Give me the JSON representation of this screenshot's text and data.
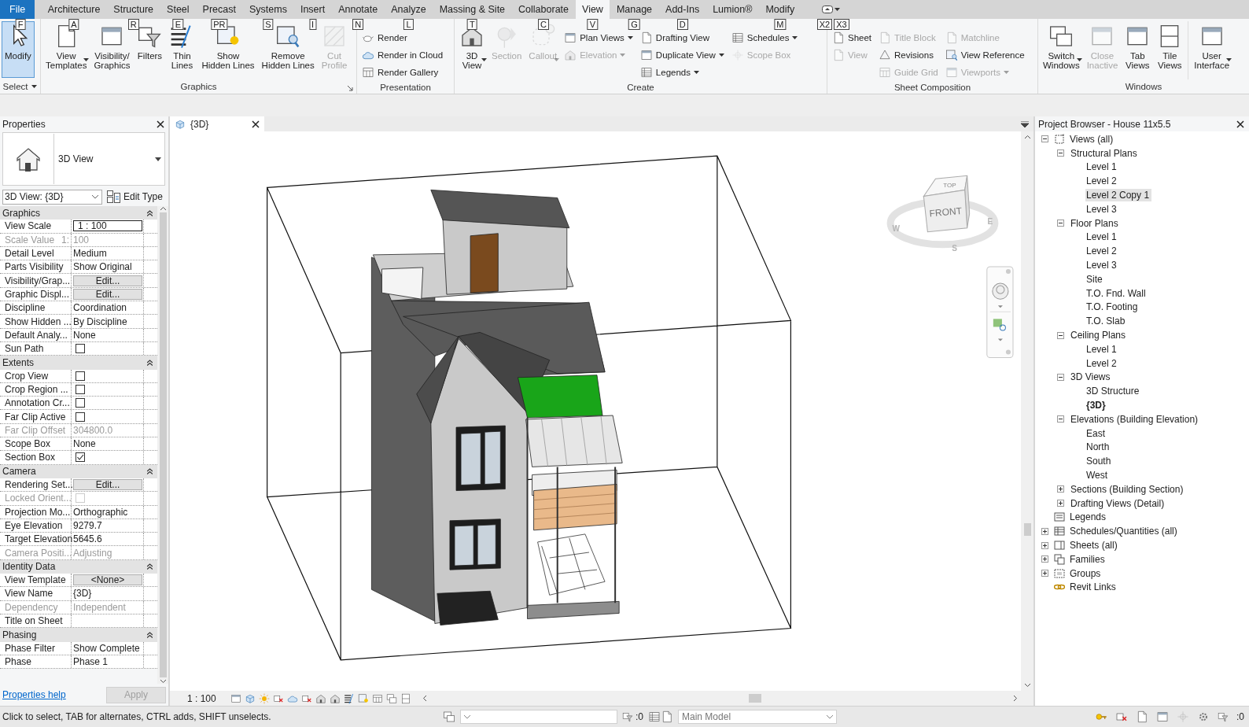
{
  "menu_tabs": [
    {
      "label": "File",
      "keytip": "F",
      "selected": false,
      "kind": "file"
    },
    {
      "label": "Architecture",
      "keytip": "A",
      "selected": false,
      "kind": "tab"
    },
    {
      "label": "Structure",
      "keytip": "R",
      "selected": false,
      "kind": "tab"
    },
    {
      "label": "Steel",
      "keytip": "E",
      "selected": false,
      "kind": "tab"
    },
    {
      "label": "Precast",
      "keytip": "PR",
      "selected": false,
      "kind": "tab"
    },
    {
      "label": "Systems",
      "keytip": "S",
      "selected": false,
      "kind": "tab"
    },
    {
      "label": "Insert",
      "keytip": "I",
      "selected": false,
      "kind": "tab"
    },
    {
      "label": "Annotate",
      "keytip": "N",
      "selected": false,
      "kind": "tab"
    },
    {
      "label": "Analyze",
      "keytip": "L",
      "selected": false,
      "kind": "tab"
    },
    {
      "label": "Massing & Site",
      "keytip": "T",
      "selected": false,
      "kind": "tab"
    },
    {
      "label": "Collaborate",
      "keytip": "C",
      "selected": false,
      "kind": "tab"
    },
    {
      "label": "View",
      "keytip": "V",
      "selected": true,
      "kind": "tab"
    },
    {
      "label": "Manage",
      "keytip": "G",
      "selected": false,
      "kind": "tab"
    },
    {
      "label": "Add-Ins",
      "keytip": "D",
      "selected": false,
      "kind": "tab"
    },
    {
      "label": "Lumion®",
      "selected": false,
      "kind": "tab"
    },
    {
      "label": "Modify",
      "keytip": "M",
      "selected": false,
      "kind": "tab"
    }
  ],
  "ribbon_toggle": {
    "keytips": [
      "X2",
      "X3"
    ]
  },
  "ribbon": {
    "panels": [
      {
        "title": "Select",
        "menu": true,
        "items": [
          {
            "kind": "large",
            "label": "Modify",
            "selected": true,
            "disabled": false
          }
        ]
      },
      {
        "title": "Graphics",
        "launcher": true,
        "items": [
          {
            "kind": "large",
            "label": "View\nTemplates",
            "selected": false,
            "disabled": false,
            "dropdown": true
          },
          {
            "kind": "large",
            "label": "Visibility/\nGraphics",
            "selected": false,
            "disabled": false
          },
          {
            "kind": "large",
            "label": "Filters",
            "selected": false,
            "disabled": false
          },
          {
            "kind": "large",
            "label": "Thin\nLines",
            "selected": false,
            "disabled": false
          },
          {
            "kind": "large",
            "label": "Show\nHidden Lines",
            "selected": false,
            "disabled": false
          },
          {
            "kind": "large",
            "label": "Remove\nHidden Lines",
            "selected": false,
            "disabled": false
          },
          {
            "kind": "large",
            "label": "Cut\nProfile",
            "selected": false,
            "disabled": true
          }
        ]
      },
      {
        "title": "Presentation",
        "items": [
          {
            "kind": "stack",
            "buttons": [
              {
                "label": "Render",
                "disabled": false
              },
              {
                "label": "Render in Cloud",
                "disabled": false
              },
              {
                "label": "Render Gallery",
                "disabled": false
              }
            ]
          }
        ]
      },
      {
        "title": "Create",
        "items": [
          {
            "kind": "large",
            "label": "3D\nView",
            "selected": false,
            "disabled": false,
            "dropdown": true
          },
          {
            "kind": "large",
            "label": "Section",
            "selected": false,
            "disabled": true
          },
          {
            "kind": "large",
            "label": "Callout",
            "selected": false,
            "disabled": true,
            "dropdown": true
          },
          {
            "kind": "stack",
            "buttons": [
              {
                "label": "Plan Views",
                "disabled": false,
                "dropdown": true
              },
              {
                "label": "Elevation",
                "disabled": true,
                "dropdown": true
              }
            ]
          },
          {
            "kind": "stack",
            "buttons": [
              {
                "label": "Drafting View",
                "disabled": false
              },
              {
                "label": "Duplicate View",
                "disabled": false,
                "dropdown": true
              },
              {
                "label": "Legends",
                "disabled": false,
                "dropdown": true
              }
            ]
          },
          {
            "kind": "stack",
            "buttons": [
              {
                "label": "Schedules",
                "disabled": false,
                "dropdown": true
              },
              {
                "label": "Scope Box",
                "disabled": true
              }
            ]
          }
        ]
      },
      {
        "title": "Sheet Composition",
        "items": [
          {
            "kind": "stack",
            "buttons": [
              {
                "label": "Sheet",
                "disabled": false
              },
              {
                "label": "View",
                "disabled": true
              }
            ]
          },
          {
            "kind": "stack",
            "buttons": [
              {
                "label": "Title Block",
                "disabled": true
              },
              {
                "label": "Revisions",
                "disabled": false
              },
              {
                "label": "Guide Grid",
                "disabled": true
              }
            ]
          },
          {
            "kind": "stack",
            "buttons": [
              {
                "label": "Matchline",
                "disabled": true
              },
              {
                "label": "View Reference",
                "disabled": false
              },
              {
                "label": "Viewports",
                "disabled": true,
                "dropdown": true
              }
            ]
          }
        ]
      },
      {
        "title": "Windows",
        "items": [
          {
            "kind": "large",
            "label": "Switch\nWindows",
            "selected": false,
            "disabled": false,
            "dropdown": true
          },
          {
            "kind": "large",
            "label": "Close\nInactive",
            "selected": false,
            "disabled": true
          },
          {
            "kind": "large",
            "label": "Tab\nViews",
            "selected": false,
            "disabled": false
          },
          {
            "kind": "large",
            "label": "Tile\nViews",
            "selected": false,
            "disabled": false
          },
          {
            "kind": "large",
            "label": "User\nInterface",
            "selected": false,
            "disabled": false,
            "dropdown": true
          }
        ]
      }
    ]
  },
  "properties": {
    "title": "Properties",
    "type_name": "3D View",
    "instance_selector": "3D View: {3D}",
    "edit_type": "Edit Type",
    "groups": [
      {
        "title": "Graphics",
        "rows": [
          {
            "label": "View Scale",
            "kind": "field",
            "value": "1 : 100",
            "disabled": false
          },
          {
            "label": "Scale Value",
            "unit": "1:",
            "kind": "text",
            "value": "100",
            "disabled": true
          },
          {
            "label": "Detail Level",
            "kind": "text",
            "value": "Medium",
            "disabled": false
          },
          {
            "label": "Parts Visibility",
            "kind": "text",
            "value": "Show Original",
            "disabled": false
          },
          {
            "label": "Visibility/Grap...",
            "kind": "button",
            "value": "Edit...",
            "disabled": false
          },
          {
            "label": "Graphic Displ...",
            "kind": "button",
            "value": "Edit...",
            "disabled": false
          },
          {
            "label": "Discipline",
            "kind": "text",
            "value": "Coordination",
            "disabled": false
          },
          {
            "label": "Show Hidden ...",
            "kind": "text",
            "value": "By Discipline",
            "disabled": false
          },
          {
            "label": "Default Analy...",
            "kind": "text",
            "value": "None",
            "disabled": false
          },
          {
            "label": "Sun Path",
            "kind": "checkbox",
            "checked": false,
            "disabled": false
          }
        ]
      },
      {
        "title": "Extents",
        "rows": [
          {
            "label": "Crop View",
            "kind": "checkbox",
            "checked": false,
            "disabled": false
          },
          {
            "label": "Crop Region ...",
            "kind": "checkbox",
            "checked": false,
            "disabled": false
          },
          {
            "label": "Annotation Cr...",
            "kind": "checkbox",
            "checked": false,
            "disabled": false
          },
          {
            "label": "Far Clip Active",
            "kind": "checkbox",
            "checked": false,
            "disabled": false
          },
          {
            "label": "Far Clip Offset",
            "kind": "text",
            "value": "304800.0",
            "disabled": true
          },
          {
            "label": "Scope Box",
            "kind": "text",
            "value": "None",
            "disabled": false
          },
          {
            "label": "Section Box",
            "kind": "checkbox",
            "checked": true,
            "disabled": false
          }
        ]
      },
      {
        "title": "Camera",
        "rows": [
          {
            "label": "Rendering Set...",
            "kind": "button",
            "value": "Edit...",
            "disabled": false
          },
          {
            "label": "Locked Orient...",
            "kind": "checkbox",
            "checked": false,
            "disabled": true
          },
          {
            "label": "Projection Mo...",
            "kind": "text",
            "value": "Orthographic",
            "disabled": false
          },
          {
            "label": "Eye Elevation",
            "kind": "text",
            "value": "9279.7",
            "disabled": false
          },
          {
            "label": "Target Elevation",
            "kind": "text",
            "value": "5645.6",
            "disabled": false
          },
          {
            "label": "Camera Positi...",
            "kind": "text",
            "value": "Adjusting",
            "disabled": true
          }
        ]
      },
      {
        "title": "Identity Data",
        "rows": [
          {
            "label": "View Template",
            "kind": "button",
            "value": "<None>",
            "disabled": false
          },
          {
            "label": "View Name",
            "kind": "text",
            "value": "{3D}",
            "disabled": false
          },
          {
            "label": "Dependency",
            "kind": "text",
            "value": "Independent",
            "disabled": true
          },
          {
            "label": "Title on Sheet",
            "kind": "text",
            "disabled": false
          }
        ]
      },
      {
        "title": "Phasing",
        "rows": [
          {
            "label": "Phase Filter",
            "kind": "text",
            "value": "Show Complete",
            "disabled": false
          },
          {
            "label": "Phase",
            "kind": "text",
            "value": "Phase 1",
            "disabled": false
          }
        ]
      }
    ],
    "help_link": "Properties help",
    "apply": {
      "label": "Apply",
      "disabled": true
    }
  },
  "view_tab": {
    "title": "{3D}"
  },
  "viewcube": {
    "face": "FRONT",
    "top": "TOP",
    "compass": [
      "W",
      "E",
      "S"
    ]
  },
  "view_control_bar": {
    "scale": "1 : 100"
  },
  "project_browser": {
    "title": "Project Browser - House 11x5.5",
    "tree": [
      {
        "label": "Views (all)",
        "kind": "views",
        "expanded": true,
        "selected": false,
        "current": false,
        "children": [
          {
            "label": "Structural Plans",
            "expanded": true,
            "selected": false,
            "current": false,
            "children": [
              {
                "label": "Level 1",
                "selected": false,
                "current": false
              },
              {
                "label": "Level 2",
                "selected": false,
                "current": false
              },
              {
                "label": "Level 2 Copy 1",
                "selected": true,
                "current": false
              },
              {
                "label": "Level 3",
                "selected": false,
                "current": false
              }
            ]
          },
          {
            "label": "Floor Plans",
            "expanded": true,
            "selected": false,
            "current": false,
            "children": [
              {
                "label": "Level 1",
                "selected": false,
                "current": false
              },
              {
                "label": "Level 2",
                "selected": false,
                "current": false
              },
              {
                "label": "Level 3",
                "selected": false,
                "current": false
              },
              {
                "label": "Site",
                "selected": false,
                "current": false
              },
              {
                "label": "T.O. Fnd. Wall",
                "selected": false,
                "current": false
              },
              {
                "label": "T.O. Footing",
                "selected": false,
                "current": false
              },
              {
                "label": "T.O. Slab",
                "selected": false,
                "current": false
              }
            ]
          },
          {
            "label": "Ceiling Plans",
            "expanded": true,
            "selected": false,
            "current": false,
            "children": [
              {
                "label": "Level 1",
                "selected": false,
                "current": false
              },
              {
                "label": "Level 2",
                "selected": false,
                "current": false
              }
            ]
          },
          {
            "label": "3D Views",
            "expanded": true,
            "selected": false,
            "current": false,
            "children": [
              {
                "label": "3D Structure",
                "selected": false,
                "current": false
              },
              {
                "label": "{3D}",
                "selected": false,
                "current": true
              }
            ]
          },
          {
            "label": "Elevations (Building Elevation)",
            "expanded": true,
            "selected": false,
            "current": false,
            "children": [
              {
                "label": "East",
                "selected": false,
                "current": false
              },
              {
                "label": "North",
                "selected": false,
                "current": false
              },
              {
                "label": "South",
                "selected": false,
                "current": false
              },
              {
                "label": "West",
                "selected": false,
                "current": false
              }
            ]
          },
          {
            "label": "Sections (Building Section)",
            "expanded": false,
            "selected": false,
            "current": false
          },
          {
            "label": "Drafting Views (Detail)",
            "expanded": false,
            "selected": false,
            "current": false
          }
        ]
      },
      {
        "label": "Legends",
        "kind": "legends",
        "selected": false,
        "current": false
      },
      {
        "label": "Schedules/Quantities (all)",
        "kind": "schedules",
        "expanded": false,
        "selected": false,
        "current": false
      },
      {
        "label": "Sheets (all)",
        "kind": "sheets",
        "expanded": false,
        "selected": false,
        "current": false
      },
      {
        "label": "Families",
        "kind": "families",
        "expanded": false,
        "selected": false,
        "current": false
      },
      {
        "label": "Groups",
        "kind": "groups",
        "expanded": false,
        "selected": false,
        "current": false
      },
      {
        "label": "Revit Links",
        "kind": "links",
        "selected": false,
        "current": false
      }
    ]
  },
  "status_bar": {
    "message": "Click to select, TAB for alternates, CTRL adds, SHIFT unselects.",
    "counts": [
      ":0",
      ":0"
    ],
    "model": "Main Model"
  }
}
